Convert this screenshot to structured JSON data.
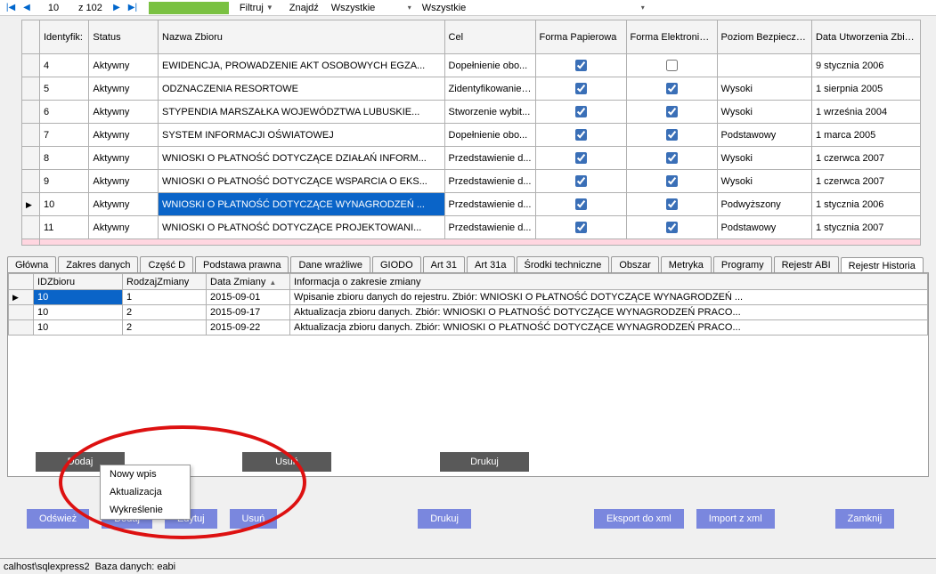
{
  "toolbar": {
    "pos": "10",
    "total": "z 102",
    "filter": "Filtruj",
    "find": "Znajdź",
    "all1": "Wszystkie",
    "all2": "Wszystkie"
  },
  "grid": {
    "headers": {
      "id": "Identyfik:",
      "status": "Status",
      "name": "Nazwa Zbioru",
      "cel": "Cel",
      "fp": "Forma Papierowa",
      "fe": "Forma Elektroniczna",
      "poz": "Poziom Bezpieczeństwa",
      "date": "Data Utworzenia Zbioru"
    },
    "rows": [
      {
        "id": "4",
        "status": "Aktywny",
        "name": "EWIDENCJA, PROWADZENIE AKT OSOBOWYCH EGZA...",
        "cel": "Dopełnienie obo...",
        "fp": true,
        "fe": false,
        "poz": "",
        "date": "9 stycznia 2006"
      },
      {
        "id": "5",
        "status": "Aktywny",
        "name": "ODZNACZENIA RESORTOWE",
        "cel": "Zidentyfikowanie ...",
        "fp": true,
        "fe": true,
        "poz": "Wysoki",
        "date": "1 sierpnia 2005"
      },
      {
        "id": "6",
        "status": "Aktywny",
        "name": "STYPENDIA MARSZAŁKA WOJEWÓDZTWA LUBUSKIE...",
        "cel": "Stworzenie wybit...",
        "fp": true,
        "fe": true,
        "poz": "Wysoki",
        "date": "1 września 2004"
      },
      {
        "id": "7",
        "status": "Aktywny",
        "name": "SYSTEM INFORMACJI OŚWIATOWEJ",
        "cel": "Dopełnienie obo...",
        "fp": true,
        "fe": true,
        "poz": "Podstawowy",
        "date": "1 marca 2005"
      },
      {
        "id": "8",
        "status": "Aktywny",
        "name": "WNIOSKI O PŁATNOŚĆ DOTYCZĄCE DZIAŁAŃ INFORM...",
        "cel": "Przedstawienie d...",
        "fp": true,
        "fe": true,
        "poz": "Wysoki",
        "date": "1 czerwca 2007"
      },
      {
        "id": "9",
        "status": "Aktywny",
        "name": "WNIOSKI O PŁATNOŚĆ DOTYCZĄCE WSPARCIA O EKS...",
        "cel": "Przedstawienie d...",
        "fp": true,
        "fe": true,
        "poz": "Wysoki",
        "date": "1 czerwca 2007"
      },
      {
        "id": "10",
        "status": "Aktywny",
        "name": "WNIOSKI O PŁATNOŚĆ DOTYCZĄCE WYNAGRODZEŃ ...",
        "cel": "Przedstawienie d...",
        "fp": true,
        "fe": true,
        "poz": "Podwyższony",
        "date": "1 stycznia 2006",
        "selected": true,
        "arrow": true
      },
      {
        "id": "11",
        "status": "Aktywny",
        "name": "WNIOSKI O PŁATNOŚĆ DOTYCZĄCE PROJEKTOWANI...",
        "cel": "Przedstawienie d...",
        "fp": true,
        "fe": true,
        "poz": "Podstawowy",
        "date": "1 stycznia 2007"
      }
    ]
  },
  "tabs": [
    "Główna",
    "Zakres danych",
    "Część D",
    "Podstawa prawna",
    "Dane wrażliwe",
    "GIODO",
    "Art 31",
    "Art 31a",
    "Środki techniczne",
    "Obszar",
    "Metryka",
    "Programy",
    "Rejestr ABI",
    "Rejestr Historia"
  ],
  "activeTab": 13,
  "subgrid": {
    "headers": {
      "id": "IDZbioru",
      "rodzaj": "RodzajZmiany",
      "data": "Data Zmiany",
      "info": "Informacja o zakresie zmiany"
    },
    "rows": [
      {
        "id": "10",
        "rodzaj": "1",
        "data": "2015-09-01",
        "info": "Wpisanie zbioru danych do rejestru. Zbiór: WNIOSKI O PŁATNOŚĆ DOTYCZĄCE WYNAGRODZEŃ ...",
        "selected": true,
        "arrow": true
      },
      {
        "id": "10",
        "rodzaj": "2",
        "data": "2015-09-17",
        "info": "Aktualizacja zbioru danych. Zbiór: WNIOSKI O PŁATNOŚĆ DOTYCZĄCE WYNAGRODZEŃ PRACO..."
      },
      {
        "id": "10",
        "rodzaj": "2",
        "data": "2015-09-22",
        "info": "Aktualizacja zbioru danych. Zbiór: WNIOSKI O PŁATNOŚĆ DOTYCZĄCE WYNAGRODZEŃ PRACO..."
      }
    ]
  },
  "buttons1": {
    "dodaj": "Dodaj",
    "usun": "Usuń",
    "drukuj": "Drukuj"
  },
  "menu": [
    "Nowy wpis",
    "Aktualizacja",
    "Wykreślenie"
  ],
  "buttons2": [
    "Odśwież",
    "Dodaj",
    "Edytuj",
    "Usuń",
    "Drukuj",
    "Eksport do xml",
    "Import z xml",
    "Zamknij"
  ],
  "status": {
    "host": "calhost\\sqlexpress2",
    "db": "Baza danych: eabi"
  }
}
